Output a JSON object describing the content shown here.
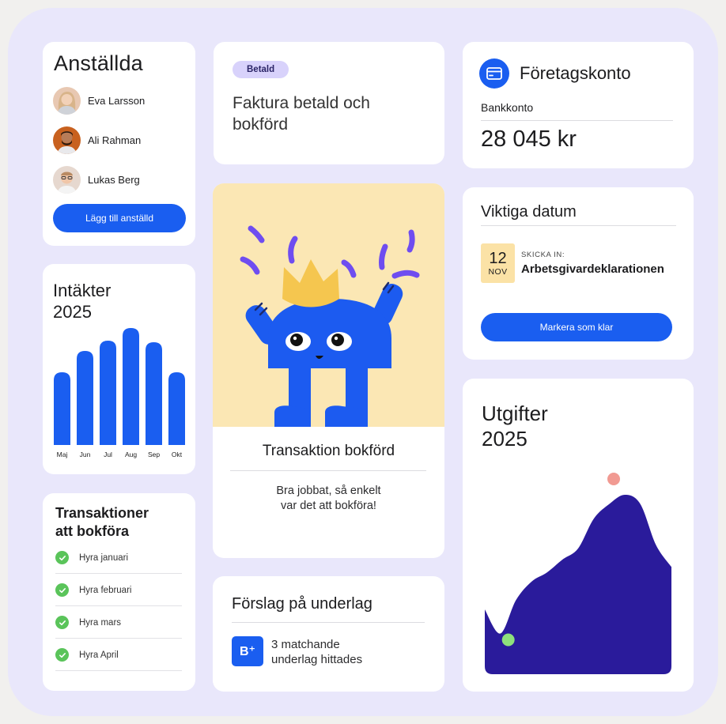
{
  "employees": {
    "title": "Anställda",
    "list": [
      {
        "name": "Eva Larsson"
      },
      {
        "name": "Ali Rahman"
      },
      {
        "name": "Lukas Berg"
      }
    ],
    "add_button": "Lägg till anställd"
  },
  "income": {
    "title": "Intäkter\n2025",
    "chart_data": {
      "type": "bar",
      "title": "Intäkter 2025",
      "categories": [
        "Maj",
        "Jun",
        "Jul",
        "Aug",
        "Sep",
        "Okt"
      ],
      "values": [
        92,
        119,
        132,
        148,
        130,
        92
      ],
      "ylim": [
        0,
        150
      ],
      "color": "#1a5ef0",
      "grid": false
    }
  },
  "transactions": {
    "title": "Transaktioner\natt bokföra",
    "items": [
      {
        "label": "Hyra januari"
      },
      {
        "label": "Hyra februari"
      },
      {
        "label": "Hyra mars"
      },
      {
        "label": "Hyra April"
      }
    ],
    "check_color": "#5ac45a"
  },
  "invoice": {
    "badge": "Betald",
    "text": "Faktura betald och\nbokförd"
  },
  "hero": {
    "title": "Transaktion bokförd",
    "subtitle": "Bra jobbat, så enkelt\nvar det att bokföra!"
  },
  "suggestions": {
    "title": "Förslag på underlag",
    "icon_text": "B⁺",
    "text": "3 matchande\nunderlag hittades"
  },
  "account": {
    "title": "Företagskonto",
    "label": "Bankkonto",
    "amount": "28 045 kr",
    "icon": "card-icon"
  },
  "dates": {
    "title": "Viktiga datum",
    "day": "12",
    "month": "NOV",
    "caption": "SKICKA IN:",
    "name": "Arbetsgivardeklarationen",
    "button": "Markera som klar"
  },
  "expenses": {
    "title": "Utgifter\n2025",
    "chart_data": {
      "type": "area",
      "title": "Utgifter 2025",
      "x": [
        0,
        1,
        2,
        3,
        4,
        5,
        6,
        7,
        8,
        9,
        10,
        11,
        12
      ],
      "values": [
        35,
        22,
        40,
        50,
        55,
        62,
        68,
        84,
        92,
        97,
        92,
        70,
        58
      ],
      "ylim": [
        0,
        100
      ],
      "fill": "#2a1b9b",
      "low_marker_color": "#8ee07c",
      "high_marker_color": "#f19a92"
    }
  },
  "colors": {
    "accent": "#1a5ef0",
    "background": "#e9e7fb",
    "hero_background": "#fbe7b4",
    "badge_background": "#d8d2fb"
  }
}
